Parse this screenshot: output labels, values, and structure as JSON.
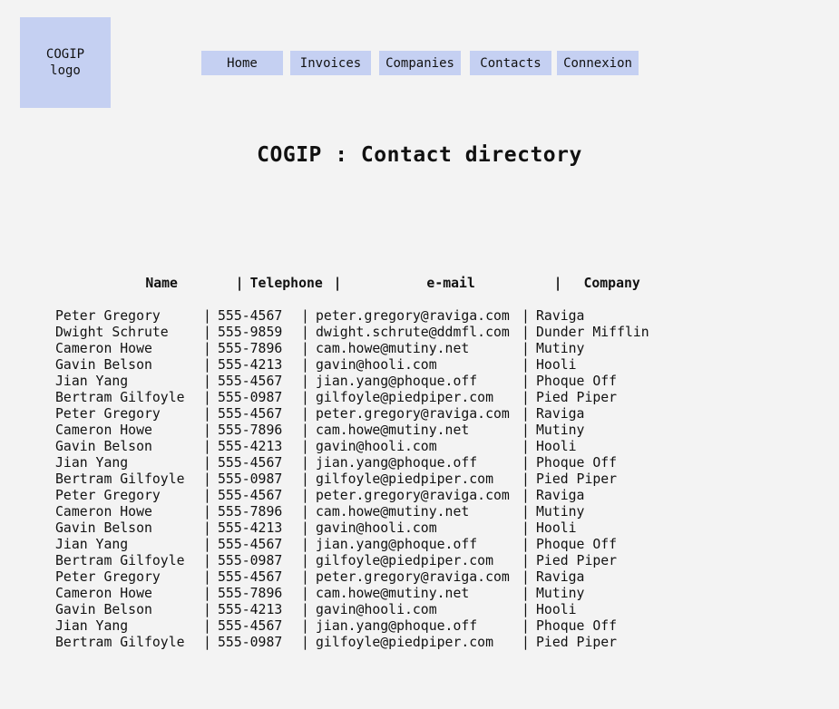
{
  "logo": {
    "line1": "COGIP",
    "line2": "logo"
  },
  "nav": {
    "home": "Home",
    "invoices": "Invoices",
    "companies": "Companies",
    "contacts": "Contacts",
    "connexion": "Connexion"
  },
  "page_title": "COGIP : Contact directory",
  "table": {
    "separator": "|",
    "headers": {
      "name": "Name",
      "telephone": "Telephone",
      "email": "e-mail",
      "company": "Company"
    },
    "rows": [
      {
        "name": "Peter Gregory",
        "telephone": "555-4567",
        "email": "peter.gregory@raviga.com",
        "company": "Raviga"
      },
      {
        "name": "Dwight Schrute",
        "telephone": "555-9859",
        "email": "dwight.schrute@ddmfl.com",
        "company": "Dunder Mifflin"
      },
      {
        "name": "Cameron Howe",
        "telephone": "555-7896",
        "email": "cam.howe@mutiny.net",
        "company": "Mutiny"
      },
      {
        "name": "Gavin Belson",
        "telephone": "555-4213",
        "email": "gavin@hooli.com",
        "company": "Hooli"
      },
      {
        "name": "Jian Yang",
        "telephone": "555-4567",
        "email": "jian.yang@phoque.off",
        "company": "Phoque Off"
      },
      {
        "name": "Bertram Gilfoyle",
        "telephone": "555-0987",
        "email": "gilfoyle@piedpiper.com",
        "company": "Pied Piper"
      },
      {
        "name": "Peter Gregory",
        "telephone": "555-4567",
        "email": "peter.gregory@raviga.com",
        "company": "Raviga"
      },
      {
        "name": "Cameron Howe",
        "telephone": "555-7896",
        "email": "cam.howe@mutiny.net",
        "company": "Mutiny"
      },
      {
        "name": "Gavin Belson",
        "telephone": "555-4213",
        "email": "gavin@hooli.com",
        "company": "Hooli"
      },
      {
        "name": "Jian Yang",
        "telephone": "555-4567",
        "email": "jian.yang@phoque.off",
        "company": "Phoque Off"
      },
      {
        "name": "Bertram Gilfoyle",
        "telephone": "555-0987",
        "email": "gilfoyle@piedpiper.com",
        "company": "Pied Piper"
      },
      {
        "name": "Peter Gregory",
        "telephone": "555-4567",
        "email": "peter.gregory@raviga.com",
        "company": "Raviga"
      },
      {
        "name": "Cameron Howe",
        "telephone": "555-7896",
        "email": "cam.howe@mutiny.net",
        "company": "Mutiny"
      },
      {
        "name": "Gavin Belson",
        "telephone": "555-4213",
        "email": "gavin@hooli.com",
        "company": "Hooli"
      },
      {
        "name": "Jian Yang",
        "telephone": "555-4567",
        "email": "jian.yang@phoque.off",
        "company": "Phoque Off"
      },
      {
        "name": "Bertram Gilfoyle",
        "telephone": "555-0987",
        "email": "gilfoyle@piedpiper.com",
        "company": "Pied Piper"
      },
      {
        "name": "Peter Gregory",
        "telephone": "555-4567",
        "email": "peter.gregory@raviga.com",
        "company": "Raviga"
      },
      {
        "name": "Cameron Howe",
        "telephone": "555-7896",
        "email": "cam.howe@mutiny.net",
        "company": "Mutiny"
      },
      {
        "name": "Gavin Belson",
        "telephone": "555-4213",
        "email": "gavin@hooli.com",
        "company": "Hooli"
      },
      {
        "name": "Jian Yang",
        "telephone": "555-4567",
        "email": "jian.yang@phoque.off",
        "company": "Phoque Off"
      },
      {
        "name": "Bertram Gilfoyle",
        "telephone": "555-0987",
        "email": "gilfoyle@piedpiper.com",
        "company": "Pied Piper"
      }
    ]
  },
  "colors": {
    "nav_bg": "#c5d0f2",
    "page_bg": "#f3f3f3"
  }
}
